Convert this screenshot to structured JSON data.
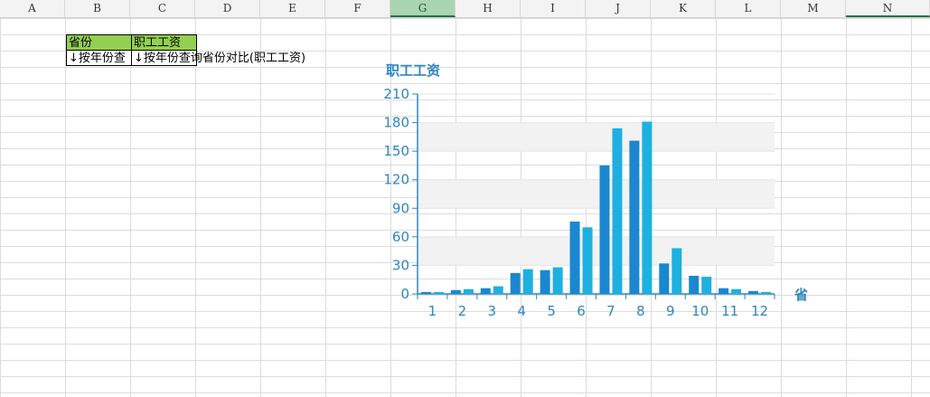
{
  "sheet": {
    "columns": [
      "A",
      "B",
      "C",
      "D",
      "E",
      "F",
      "G",
      "H",
      "I",
      "J",
      "K",
      "L",
      "M",
      "N"
    ],
    "selected_column": "G",
    "active_column": "N",
    "cells": {
      "B2": "省份",
      "C2": "职工工资",
      "B3": "↓按年份查",
      "C3": "↓按年份查询省份对比(职工工资)"
    }
  },
  "colors": {
    "header_fill": "#92d050",
    "series_dark": "#1a87d0",
    "series_light": "#1eb0e0",
    "axis_text": "#2e86c1"
  },
  "chart_data": {
    "type": "bar",
    "title": "职工工资",
    "xlabel": "省",
    "ylabel": "",
    "categories": [
      "1",
      "2",
      "3",
      "4",
      "5",
      "6",
      "7",
      "8",
      "9",
      "10",
      "11",
      "12"
    ],
    "series": [
      {
        "values": [
          2,
          4,
          6,
          22,
          25,
          76,
          135,
          161,
          32,
          19,
          6,
          3
        ]
      },
      {
        "values": [
          2,
          5,
          8,
          26,
          28,
          70,
          174,
          181,
          48,
          18,
          5,
          2
        ]
      }
    ],
    "ylim": [
      0,
      210
    ],
    "yticks": [
      0,
      30,
      60,
      90,
      120,
      150,
      180,
      210
    ],
    "grid": true
  }
}
